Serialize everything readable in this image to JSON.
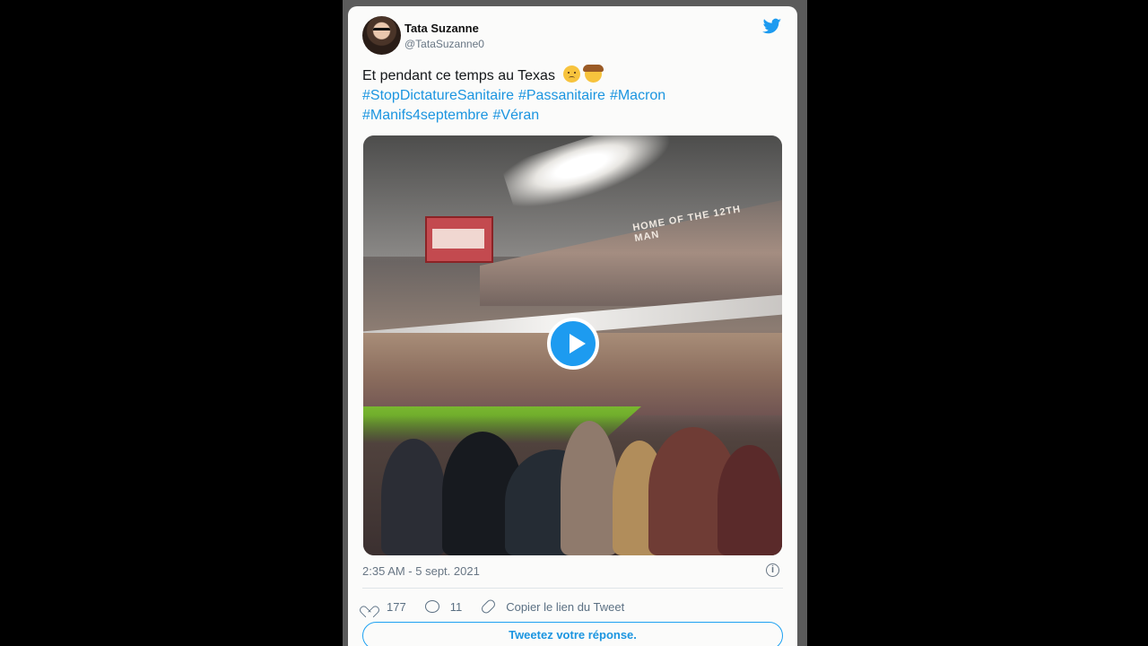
{
  "tweet": {
    "author_name": "Tata Suzanne",
    "handle": "@TataSuzanne0",
    "text_intro": "Et pendant ce temps au Texas",
    "hashtags": [
      "#StopDictatureSanitaire",
      "#Passanitaire",
      "#Macron",
      "#Manifs4septembre",
      "#Véran"
    ],
    "media": {
      "banner_text": "HOME OF THE 12TH MAN"
    },
    "timestamp": "2:35 AM - 5 sept. 2021",
    "info_symbol": "i",
    "likes": "177",
    "replies": "11",
    "copy_link_label": "Copier le lien du Tweet",
    "reply_prompt": "Tweetez votre réponse."
  },
  "icons": {
    "bird": "twitter-bird-icon",
    "play": "play-icon",
    "heart": "heart-icon",
    "reply": "reply-icon",
    "link": "link-icon",
    "info": "info-icon"
  },
  "colors": {
    "accent": "#1d9bf0",
    "hashtag": "#1b95e0",
    "muted": "#687684"
  }
}
